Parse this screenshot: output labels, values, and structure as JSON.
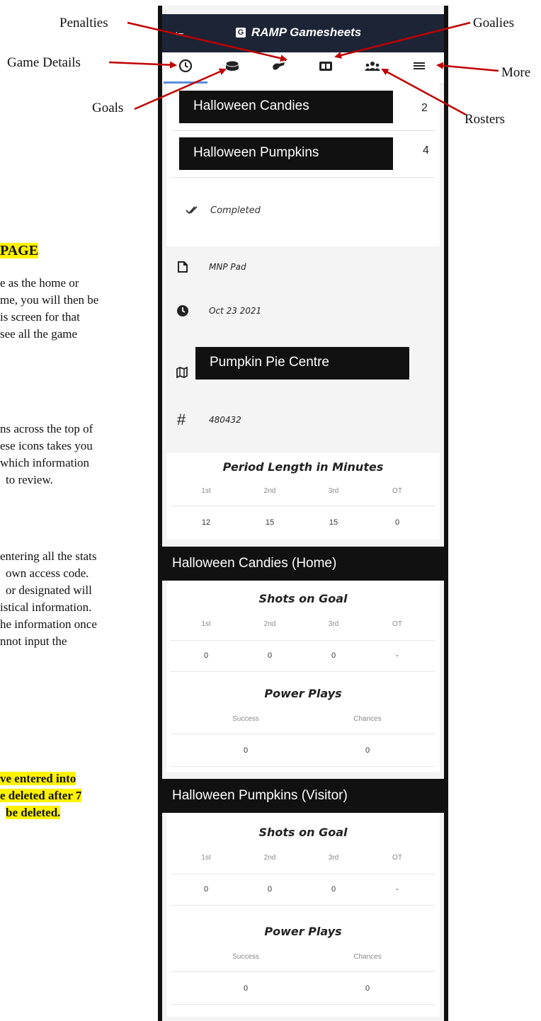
{
  "annotations": {
    "penalties": "Penalties",
    "goalies": "Goalies",
    "game_details": "Game Details",
    "more": "More",
    "goals": "Goals",
    "rosters": "Rosters"
  },
  "doc": {
    "heading": "PAGE",
    "p1": [
      "e as the home or",
      "me, you will then be",
      "is screen for that",
      "see all the game"
    ],
    "p2": [
      "ns across the top of",
      "ese icons takes you",
      "which information",
      "to review."
    ],
    "p3": [
      "entering all the stats",
      "own access code.",
      "or designated will",
      "istical information.",
      "he information once",
      "nnot input the"
    ],
    "warn": [
      "ve entered into",
      "e deleted after 7",
      "be deleted."
    ]
  },
  "app": {
    "back_icon": "←",
    "logo": "G",
    "title": "RAMP Gamesheets",
    "tabs": [
      "clock-icon",
      "puck-icon",
      "penalty-icon",
      "goalie-icon",
      "roster-icon",
      "menu-icon"
    ],
    "home_team": "Halloween Candies",
    "home_score": "2",
    "visitor_team": "Halloween Pumpkins",
    "visitor_score": "4",
    "status": "Completed",
    "details": {
      "division": "MNP Pad",
      "date": "Oct 23 2021",
      "venue": "Pumpkin Pie Centre",
      "game_number": "480432"
    },
    "period_length": {
      "title": "Period Length in Minutes",
      "headers": [
        "1st",
        "2nd",
        "3rd",
        "OT"
      ],
      "values": [
        "12",
        "15",
        "15",
        "0"
      ]
    },
    "home_section": {
      "title": "Halloween Candies (Home)",
      "shots_title": "Shots on Goal",
      "shots_headers": [
        "1st",
        "2nd",
        "3rd",
        "OT"
      ],
      "shots": [
        "0",
        "0",
        "0",
        "-"
      ],
      "pp_title": "Power Plays",
      "pp_headers": [
        "Success",
        "Chances"
      ],
      "pp": [
        "0",
        "0"
      ]
    },
    "visitor_section": {
      "title": "Halloween Pumpkins (Visitor)",
      "shots_title": "Shots on Goal",
      "shots_headers": [
        "1st",
        "2nd",
        "3rd",
        "OT"
      ],
      "shots": [
        "0",
        "0",
        "0",
        "-"
      ],
      "pp_title": "Power Plays",
      "pp_headers": [
        "Success",
        "Chances"
      ],
      "pp": [
        "0",
        "0"
      ]
    }
  }
}
